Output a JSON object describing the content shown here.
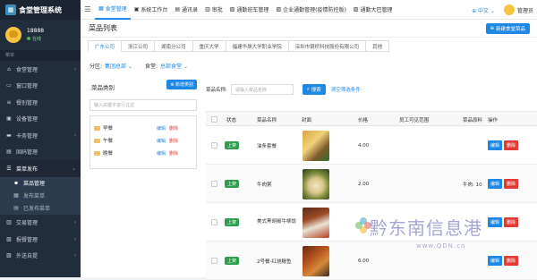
{
  "app": {
    "title": "食堂管理系统"
  },
  "user": {
    "name": "18888",
    "status": "在线"
  },
  "sidebar": {
    "section_label": "菜单",
    "items": [
      {
        "label": "食堂管理",
        "icon": "home-icon"
      },
      {
        "label": "窗口管理",
        "icon": "window-icon"
      },
      {
        "label": "餐别管理",
        "icon": "list-icon"
      },
      {
        "label": "设备管理",
        "icon": "device-icon"
      },
      {
        "label": "卡务管理",
        "icon": "card-icon"
      },
      {
        "label": "固码管理",
        "icon": "qrcode-icon"
      },
      {
        "label": "菜单发布",
        "icon": "menu-icon"
      }
    ],
    "sub_items": [
      {
        "label": "菜品管理",
        "active": true
      },
      {
        "label": "发布菜单",
        "active": false
      },
      {
        "label": "已发布菜单",
        "active": false
      }
    ],
    "bottom_items": [
      {
        "label": "交易管理",
        "icon": "trade-icon"
      },
      {
        "label": "报餐管理",
        "icon": "report-icon"
      },
      {
        "label": "外送自提",
        "icon": "delivery-icon"
      }
    ]
  },
  "topbar": {
    "nav": [
      {
        "label": "食堂管理",
        "active": true
      },
      {
        "label": "系统工作台",
        "active": false
      },
      {
        "label": "通讯录",
        "active": false
      },
      {
        "label": "审批",
        "active": false
      },
      {
        "label": "通勤班车管理",
        "active": false
      },
      {
        "label": "企业通勤管理(疫情防控版)",
        "active": false
      },
      {
        "label": "通勤大巴管理",
        "active": false
      }
    ],
    "lang": "中文",
    "admin": "管理员"
  },
  "page": {
    "title": "菜品列表",
    "new_button": "新建食堂菜品",
    "tabs": [
      "广东公司",
      "浙江公司",
      "湖南分公司",
      "重庆大学",
      "福建华晟大学职业学院",
      "深圳市银桥科技股份有限公司",
      "其他"
    ],
    "filter": {
      "area_label": "分区:",
      "area_value": "集团总部",
      "canteen_label": "食堂:",
      "canteen_value": "总部食堂"
    }
  },
  "category": {
    "title": "菜品类别",
    "add_button": "新增类别",
    "search_placeholder": "输入关键字进行过滤",
    "items": [
      "早餐",
      "午餐",
      "晚餐"
    ],
    "edit_label": "编辑",
    "delete_label": "删除"
  },
  "search": {
    "label": "菜品名称:",
    "placeholder": "请输入菜品名称",
    "button": "搜索",
    "clear": "清空筛选条件"
  },
  "table": {
    "headers": [
      "状态",
      "菜品名称",
      "封面",
      "价格",
      "员工可见范围",
      "菜品原料",
      "操作"
    ],
    "rows": [
      {
        "status": "上架",
        "name": "油条套餐",
        "price": "4.00",
        "material": ""
      },
      {
        "status": "上架",
        "name": "牛肉粥",
        "price": "2.00",
        "material": "牛肉: 10"
      },
      {
        "status": "上架",
        "name": "美式黑胡椒牛柳饭",
        "price": "",
        "material": ""
      },
      {
        "status": "上架",
        "name": "2号餐-红烧鳗鱼",
        "price": "6.00",
        "material": ""
      }
    ],
    "edit_label": "编辑",
    "delete_label": "删除"
  },
  "watermark": {
    "text": "黔东南信息港",
    "url": "www.QDN.cn"
  },
  "colors": {
    "primary": "#1e88e5",
    "danger": "#e53935",
    "success": "#2e9e4f",
    "sidebar": "#222d3c"
  }
}
